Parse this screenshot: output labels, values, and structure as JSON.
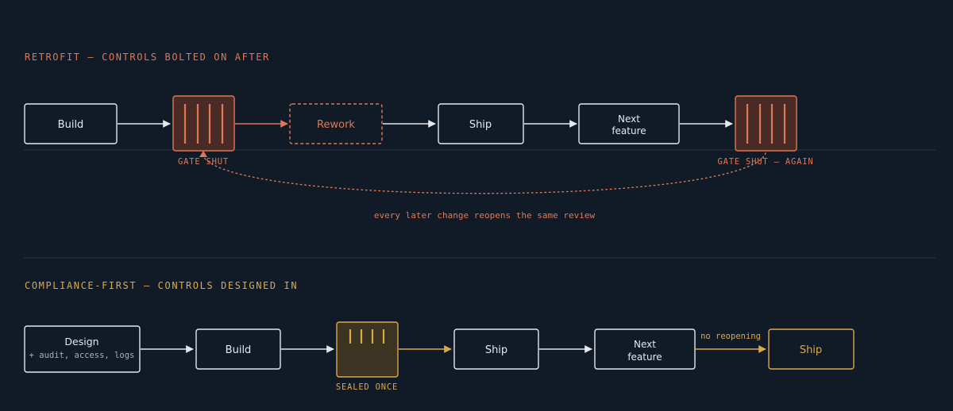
{
  "colors": {
    "background": "#111a27",
    "neutral": "#e6e8ec",
    "retrofit_accent": "#e07856",
    "retrofit_fill": "#4a2a25",
    "compliance_accent": "#d9a94a",
    "compliance_fill": "#3d3322",
    "divider": "#2b3444",
    "muted_text": "#a8b0bd"
  },
  "retrofit": {
    "title": "RETROFIT — CONTROLS BOLTED ON AFTER",
    "build": "Build",
    "rework": "Rework",
    "ship": "Ship",
    "next_line1": "Next",
    "next_line2": "feature",
    "gate1_label": "GATE SHUT",
    "gate2_label": "GATE SHUT — AGAIN",
    "loop_note": "every later change reopens the same review"
  },
  "compliance": {
    "title": "COMPLIANCE-FIRST — CONTROLS DESIGNED IN",
    "design": "Design",
    "design_sub": "+ audit, access, logs",
    "build": "Build",
    "ship": "Ship",
    "next_line1": "Next",
    "next_line2": "feature",
    "ship2": "Ship",
    "gate_label": "SEALED ONCE",
    "no_reopen_note": "no reopening"
  }
}
